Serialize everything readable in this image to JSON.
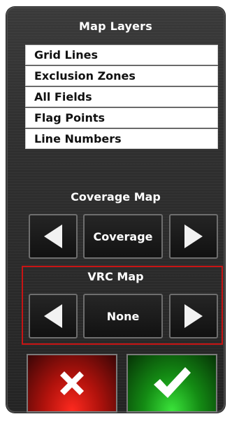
{
  "title": "Map Layers",
  "layers": [
    {
      "label": "Grid Lines"
    },
    {
      "label": "Exclusion Zones"
    },
    {
      "label": "All Fields"
    },
    {
      "label": "Flag Points"
    },
    {
      "label": "Line Numbers"
    }
  ],
  "coverage": {
    "label": "Coverage Map",
    "value": "Coverage",
    "prev_icon": "triangle-left-icon",
    "next_icon": "triangle-right-icon"
  },
  "vrc": {
    "label": "VRC Map",
    "value": "None",
    "prev_icon": "triangle-left-icon",
    "next_icon": "triangle-right-icon",
    "highlight_color": "#c81414"
  },
  "actions": {
    "cancel_icon": "cross-icon",
    "cancel_color": "#d01a12",
    "confirm_icon": "checkmark-icon",
    "confirm_color": "#1ea61e"
  }
}
